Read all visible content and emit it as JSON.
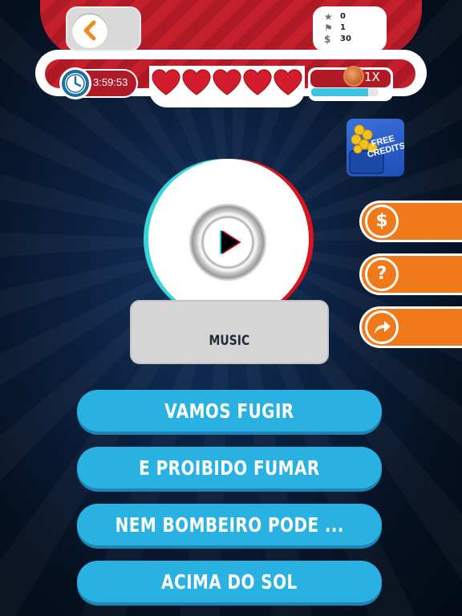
{
  "header": {
    "back_icon": "chevron-left-icon",
    "stats": [
      {
        "icon": "star-icon",
        "value": "0"
      },
      {
        "icon": "flag-icon",
        "value": "1"
      },
      {
        "icon": "dollar-icon",
        "value": "30"
      }
    ],
    "timer": "3:59:53",
    "hearts": 5,
    "multiplier": "1X",
    "progress": 0.85
  },
  "free_credits": {
    "line1": "FREE",
    "line2": "CREDITS"
  },
  "side_buttons": [
    {
      "icon": "dollar-icon",
      "glyph": "$"
    },
    {
      "icon": "question-icon",
      "glyph": "?"
    },
    {
      "icon": "share-arrow-icon",
      "glyph": "➦"
    }
  ],
  "question": {
    "category": "MUSIC"
  },
  "answers": [
    "VAMOS FUGIR",
    "E PROIBIDO FUMAR",
    "NEM BOMBEIRO PODE ...",
    "ACIMA DO SOL"
  ],
  "colors": {
    "header_red": "#c3202c",
    "answer_blue": "#29b1e2",
    "side_orange": "#f07a1a",
    "disc_cyan": "#37d6d9",
    "disc_red": "#d8141e"
  }
}
